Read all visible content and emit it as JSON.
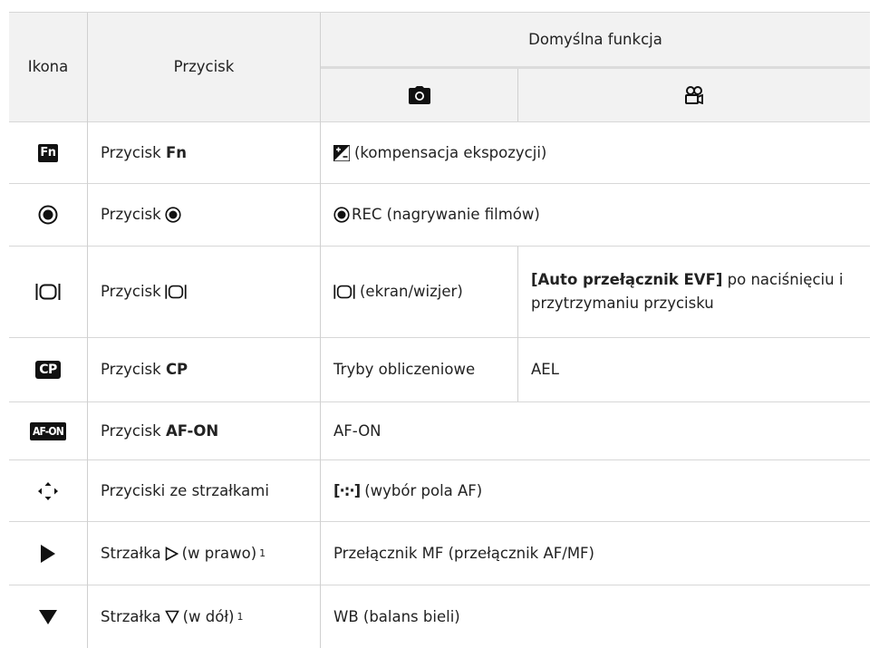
{
  "header": {
    "col_icon": "Ikona",
    "col_button": "Przycisk",
    "col_default": "Domyślna funkcja",
    "col_photo_icon": "camera-icon",
    "col_movie_icon": "movie-camera-icon"
  },
  "rows": [
    {
      "icon": "fn-icon",
      "icon_text": "Fn",
      "button_prefix": "Przycisk",
      "button_bold": "Fn",
      "default_text": "(kompensacja ekspozycji)",
      "default_icon": "exposure-compensation-icon"
    },
    {
      "icon": "record-icon",
      "button_prefix": "Przycisk",
      "default_text": "REC (nagrywanie filmów)",
      "default_icon": "record-icon"
    },
    {
      "icon": "monitor-switch-icon",
      "button_prefix": "Przycisk",
      "photo_text": "(ekran/wizjer)",
      "movie_bold": "[Auto przełącznik EVF]",
      "movie_text": " po naciśnięciu i przytrzymaniu przycisku"
    },
    {
      "icon": "cp-icon",
      "icon_text": "CP",
      "button_prefix": "Przycisk",
      "button_bold": "CP",
      "photo_text": "Tryby obliczeniowe",
      "movie_text": "AEL"
    },
    {
      "icon": "af-on-icon",
      "icon_text": "AF-ON",
      "button_prefix": "Przycisk",
      "button_bold": "AF-ON",
      "default_text": "AF-ON"
    },
    {
      "icon": "arrow-pad-icon",
      "button_text": "Przyciski ze strzałkami",
      "default_text": "(wybór pola AF)",
      "default_icon": "af-target-icon",
      "default_icon_text": "[·:·]"
    },
    {
      "icon": "play-right-icon",
      "button_prefix": "Strzałka",
      "button_suffix": "(w prawo)",
      "button_footnote": "1",
      "default_text": "Przełącznik MF (przełącznik AF/MF)"
    },
    {
      "icon": "down-triangle-icon",
      "button_prefix": "Strzałka",
      "button_suffix": "(w dół)",
      "button_footnote": "1",
      "default_text": "WB (balans bieli)"
    }
  ],
  "colors": {
    "header_bg": "#f2f2f2",
    "line": "#d7d7d7",
    "text": "#222222",
    "icon_bg": "#111111"
  }
}
